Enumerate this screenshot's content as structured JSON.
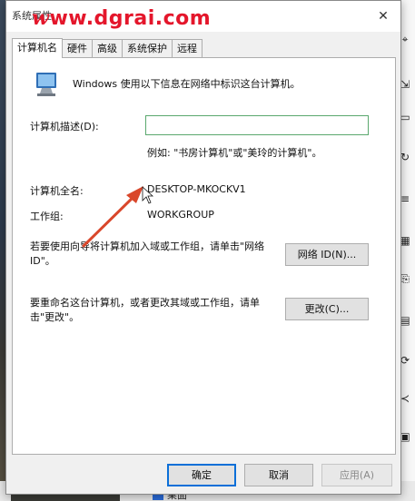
{
  "dialog": {
    "title": "系统属性",
    "close_glyph": "✕",
    "watermark": {
      "lead": "w",
      "rest": "ww.dgrai.com"
    }
  },
  "tabs": [
    {
      "label": "计算机名",
      "active": true
    },
    {
      "label": "硬件",
      "active": false
    },
    {
      "label": "高级",
      "active": false
    },
    {
      "label": "系统保护",
      "active": false
    },
    {
      "label": "远程",
      "active": false
    }
  ],
  "computer_name_tab": {
    "description": "Windows 使用以下信息在网络中标识这台计算机。",
    "computer_description_label": "计算机描述(D):",
    "computer_description_value": "",
    "hint": "例如: \"书房计算机\"或\"美玲的计算机\"。",
    "full_name_label": "计算机全名:",
    "full_name_value": "DESKTOP-MKOCKV1",
    "workgroup_label": "工作组:",
    "workgroup_value": "WORKGROUP",
    "network_id_text": "若要使用向导将计算机加入域或工作组，请单击\"网络 ID\"。",
    "network_id_button": "网络 ID(N)...",
    "rename_text": "要重命名这台计算机，或者更改其域或工作组，请单击\"更改\"。",
    "change_button": "更改(C)..."
  },
  "footer": {
    "ok": "确定",
    "cancel": "取消",
    "apply": "应用(A)"
  },
  "background": {
    "taskbar_item": "桌面"
  },
  "colors": {
    "accent": "#0a6fd8",
    "watermark": "#e4162b",
    "arrow": "#d9472b",
    "input_border": "#5aa86e"
  }
}
